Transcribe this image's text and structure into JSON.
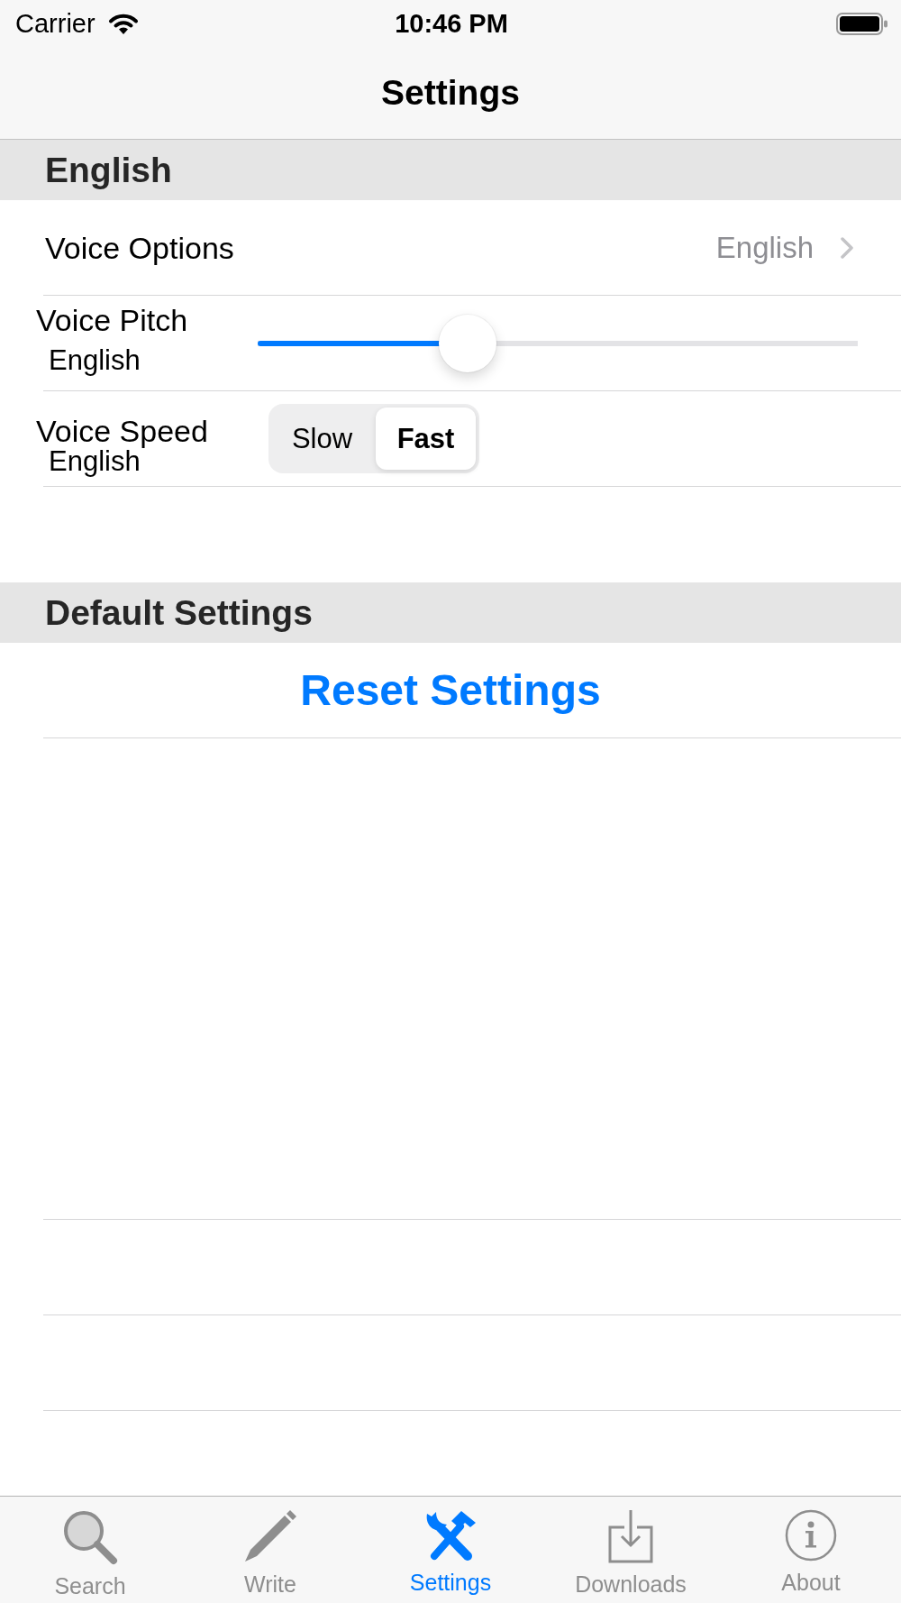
{
  "status_bar": {
    "carrier": "Carrier",
    "time": "10:46 PM"
  },
  "nav_bar": {
    "title": "Settings"
  },
  "sections": [
    {
      "header": "English",
      "rows": [
        {
          "kind": "disclosure",
          "label": "Voice Options",
          "value": "English"
        },
        {
          "kind": "slider",
          "label": "Voice Pitch",
          "sublabel": "English",
          "level": 0.35
        },
        {
          "kind": "segmented",
          "label": "Voice Speed",
          "sublabel": "English",
          "segments": [
            {
              "label": "Slow",
              "selected": false
            },
            {
              "label": "Fast",
              "selected": true
            }
          ]
        }
      ]
    },
    {
      "header": "Default Settings",
      "rows": [
        {
          "kind": "action",
          "label": "Reset Settings"
        }
      ]
    }
  ],
  "tab_bar": {
    "tabs": [
      {
        "label": "Search",
        "selected": false
      },
      {
        "label": "Write",
        "selected": false
      },
      {
        "label": "Settings",
        "selected": true
      },
      {
        "label": "Downloads",
        "selected": false
      },
      {
        "label": "About",
        "selected": false
      }
    ]
  }
}
